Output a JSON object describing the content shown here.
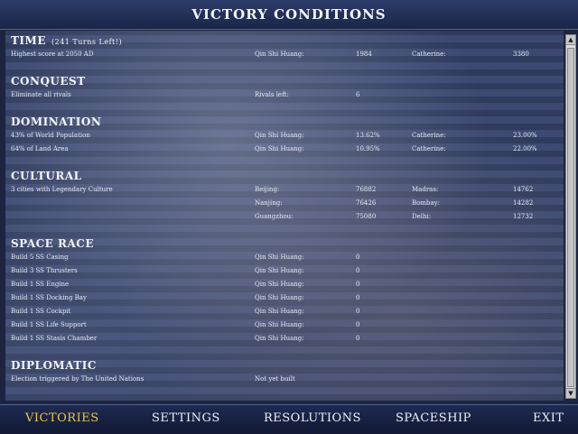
{
  "title": "VICTORY CONDITIONS",
  "sections": {
    "time": {
      "title": "TIME",
      "turns_left": "(241 Turns Left!)",
      "rows": [
        {
          "label": "Highest score at 2050 AD",
          "c2": "Qin Shi Huang:",
          "c3": "1984",
          "c4": "Catherine:",
          "c5": "3380"
        }
      ]
    },
    "conquest": {
      "title": "CONQUEST",
      "rows": [
        {
          "label": "Eliminate all rivals",
          "c2": "Rivals left:",
          "c3": "6",
          "c4": "",
          "c5": ""
        }
      ]
    },
    "domination": {
      "title": "DOMINATION",
      "rows": [
        {
          "label": "43% of World Population",
          "c2": "Qin Shi Huang:",
          "c3": "13.62%",
          "c4": "Catherine:",
          "c5": "23.00%"
        },
        {
          "label": "64% of Land Area",
          "c2": "Qin Shi Huang:",
          "c3": "10.95%",
          "c4": "Catherine:",
          "c5": "22.00%"
        }
      ]
    },
    "cultural": {
      "title": "CULTURAL",
      "rows": [
        {
          "label": "3 cities with Legendary Culture",
          "c2": "Beijing:",
          "c3": "76882",
          "c4": "Madras:",
          "c5": "14762"
        },
        {
          "label": "",
          "c2": "Nanjing:",
          "c3": "76426",
          "c4": "Bombay:",
          "c5": "14282"
        },
        {
          "label": "",
          "c2": "Guangzhou:",
          "c3": "75080",
          "c4": "Delhi:",
          "c5": "12732"
        }
      ]
    },
    "space": {
      "title": "SPACE RACE",
      "rows": [
        {
          "label": "Build 5 SS Casing",
          "c2": "Qin Shi Huang:",
          "c3": "0"
        },
        {
          "label": "Build 3 SS Thrusters",
          "c2": "Qin Shi Huang:",
          "c3": "0"
        },
        {
          "label": "Build 1 SS Engine",
          "c2": "Qin Shi Huang:",
          "c3": "0"
        },
        {
          "label": "Build 1 SS Docking Bay",
          "c2": "Qin Shi Huang:",
          "c3": "0"
        },
        {
          "label": "Build 1 SS Cockpit",
          "c2": "Qin Shi Huang:",
          "c3": "0"
        },
        {
          "label": "Build 1 SS Life Support",
          "c2": "Qin Shi Huang:",
          "c3": "0"
        },
        {
          "label": "Build 1 SS Stasis Chamber",
          "c2": "Qin Shi Huang:",
          "c3": "0"
        }
      ]
    },
    "diplomatic": {
      "title": "DIPLOMATIC",
      "rows": [
        {
          "label": "Election triggered by The United Nations",
          "c2": "Not yet built"
        }
      ]
    }
  },
  "nav": {
    "victories": "VICTORIES",
    "settings": "SETTINGS",
    "resolutions": "RESOLUTIONS",
    "spaceship": "SPACESHIP",
    "exit": "EXIT"
  },
  "scroll": {
    "up": "▲",
    "down": "▼"
  },
  "colors": {
    "active_nav": "#e8c84a",
    "text": "#e8ecf4",
    "panel": "#38456e"
  }
}
